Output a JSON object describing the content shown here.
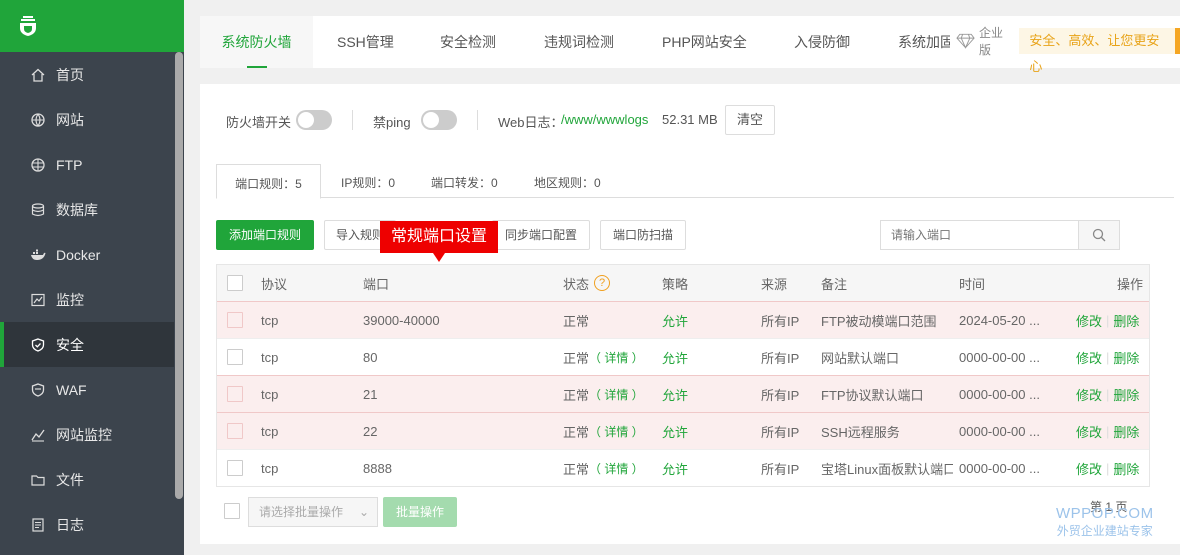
{
  "sidebar": {
    "items": [
      {
        "label": "首页",
        "icon": "home-icon"
      },
      {
        "label": "网站",
        "icon": "globe-icon"
      },
      {
        "label": "FTP",
        "icon": "ftp-globe-icon"
      },
      {
        "label": "数据库",
        "icon": "database-icon"
      },
      {
        "label": "Docker",
        "icon": "docker-icon"
      },
      {
        "label": "监控",
        "icon": "monitor-icon"
      },
      {
        "label": "安全",
        "icon": "shield-check-icon",
        "active": true
      },
      {
        "label": "WAF",
        "icon": "waf-shield-icon"
      },
      {
        "label": "网站监控",
        "icon": "chart-line-icon"
      },
      {
        "label": "文件",
        "icon": "folder-icon"
      },
      {
        "label": "日志",
        "icon": "log-icon"
      }
    ]
  },
  "top_tabs": [
    "系统防火墙",
    "SSH管理",
    "安全检测",
    "违规词检测",
    "PHP网站安全",
    "入侵防御",
    "系统加固"
  ],
  "enterprise": {
    "badge": "企业版",
    "slogan": "安全、高效、让您更安心"
  },
  "toolbar": {
    "firewall_label": "防火墙开关",
    "ping_label": "禁ping",
    "weblog_label": "Web日志：",
    "weblog_path": "/www/wwwlogs",
    "weblog_size": "52.31 MB",
    "clear_button": "清空"
  },
  "sub_tabs": [
    "端口规则：5",
    "IP规则：0",
    "端口转发：0",
    "地区规则：0"
  ],
  "actions": {
    "add": "添加端口规则",
    "import": "导入规则",
    "sync": "同步端口配置",
    "scan": "端口防扫描",
    "search_placeholder": "请输入端口"
  },
  "tooltip": "常规端口设置",
  "table": {
    "headers": {
      "protocol": "协议",
      "port": "端口",
      "status": "状态",
      "strategy": "策略",
      "source": "来源",
      "remark": "备注",
      "time": "时间",
      "ops": "操作"
    },
    "rows": [
      {
        "protocol": "tcp",
        "port": "39000-40000",
        "status": "正常",
        "detail": "",
        "strategy": "允许",
        "source": "所有IP",
        "remark": "FTP被动模端口范围",
        "time": "2024-05-20 ...",
        "edit": "修改",
        "del": "删除",
        "highlight": true
      },
      {
        "protocol": "tcp",
        "port": "80",
        "status": "正常",
        "detail": "（ 详情 ）",
        "strategy": "允许",
        "source": "所有IP",
        "remark": "网站默认端口",
        "time": "0000-00-00 ...",
        "edit": "修改",
        "del": "删除",
        "highlight": false
      },
      {
        "protocol": "tcp",
        "port": "21",
        "status": "正常",
        "detail": "（ 详情 ）",
        "strategy": "允许",
        "source": "所有IP",
        "remark": "FTP协议默认端口",
        "time": "0000-00-00 ...",
        "edit": "修改",
        "del": "删除",
        "highlight": true
      },
      {
        "protocol": "tcp",
        "port": "22",
        "status": "正常",
        "detail": "（ 详情 ）",
        "strategy": "允许",
        "source": "所有IP",
        "remark": "SSH远程服务",
        "time": "0000-00-00 ...",
        "edit": "修改",
        "del": "删除",
        "highlight": true
      },
      {
        "protocol": "tcp",
        "port": "8888",
        "status": "正常",
        "detail": "（ 详情 ）",
        "strategy": "允许",
        "source": "所有IP",
        "remark": "宝塔Linux面板默认端口",
        "time": "0000-00-00 ...",
        "edit": "修改",
        "del": "删除",
        "highlight": false
      }
    ]
  },
  "bulk": {
    "select_placeholder": "请选择批量操作",
    "button": "批量操作",
    "page": "第 1 页"
  },
  "watermark": {
    "line1": "WPPOP.COM",
    "line2": "外贸企业建站专家"
  },
  "colors": {
    "accent": "#20a53a",
    "sidebar": "#3c444d",
    "tooltip": "#ee0000",
    "highlight_row": "#fbeeee"
  }
}
